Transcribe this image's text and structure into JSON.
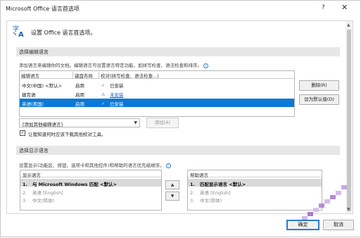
{
  "window": {
    "title": "Microsoft Office 语言首选项",
    "help": "?",
    "close": "✕"
  },
  "header": {
    "text": "设置 Office 语言首选项。"
  },
  "editing": {
    "section_title": "选择编辑语言",
    "description": "添加语言来编辑你的文档。编辑语言可设置语言特定功能，如拼写检查、语法检查和排序。",
    "columns": [
      "编辑语言",
      "键盘布局",
      "校对(拼写检查、语法检查...)"
    ],
    "rows": [
      {
        "language": "中文(中国) <默认>",
        "keyboard": "启用",
        "proofing": "已安装",
        "proofing_type": "installed"
      },
      {
        "language": "捷克语",
        "keyboard": "启用",
        "proofing": "未安装",
        "proofing_type": "link"
      },
      {
        "language": "英语(美国)",
        "keyboard": "启用",
        "proofing": "已安装",
        "proofing_type": "installed"
      }
    ],
    "delete_button": "删除(R)",
    "set_default_button": "设为默认值(D)",
    "add_dropdown_value": "[添加其他编辑语言]",
    "add_button": "添加(A)",
    "checkbox_label": "让我知道何时应该下载其他校对工具。",
    "checkbox_checked": true
  },
  "display": {
    "section_title": "选择显示语言",
    "description": "设置显示(功能区、按钮、选项卡和其他控件)和帮助的语言优先级顺序。",
    "display_header": "显示语言",
    "display_items": [
      {
        "num": "1.",
        "label": "与 Microsoft Windows 匹配 <默认>"
      },
      {
        "num": "2.",
        "label": "英语 [English]"
      },
      {
        "num": "3.",
        "label": "中文(简体)"
      }
    ],
    "help_header": "帮助语言",
    "help_items": [
      {
        "num": "1.",
        "label": "匹配显示语言 <默认>"
      },
      {
        "num": "2.",
        "label": "英语 [English]"
      },
      {
        "num": "3.",
        "label": "中文(简体)"
      }
    ],
    "up_arrow": "▲",
    "down_arrow": "▼"
  },
  "footer": {
    "ok_button": "确定",
    "cancel_button": "取消"
  },
  "icons": {
    "installed": "check-icon",
    "not_installed": "warning-icon"
  },
  "colors": {
    "selection": "#0a78d7",
    "link": "#1f5fbf",
    "section_bar": "#e7e7e7"
  }
}
